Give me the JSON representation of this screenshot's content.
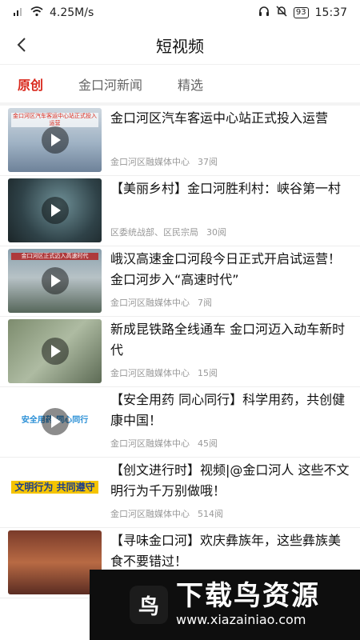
{
  "status_bar": {
    "speed": "4.25M/s",
    "battery": "93",
    "time": "15:37"
  },
  "header": {
    "title": "短视频"
  },
  "tabs": [
    {
      "label": "原创",
      "active": true
    },
    {
      "label": "金口河新闻",
      "active": false
    },
    {
      "label": "精选",
      "active": false
    }
  ],
  "items": [
    {
      "title": "金口河区汽车客运中心站正式投入运营",
      "source": "金口河区融媒体中心",
      "views": "37阅",
      "thumb_text": "金口河区汽车客运中心站正式投入运营"
    },
    {
      "title": "【美丽乡村】金口河胜利村：峡谷第一村",
      "source": "区委统战部、区民宗局",
      "views": "30阅",
      "thumb_text": ""
    },
    {
      "title": "峨汉高速金口河段今日正式开启试运营！金口河步入“高速时代”",
      "source": "金口河区融媒体中心",
      "views": "7阅",
      "thumb_text": "金口河区正式迈入高速时代"
    },
    {
      "title": "新成昆铁路全线通车 金口河迈入动车新时代",
      "source": "金口河区融媒体中心",
      "views": "15阅",
      "thumb_text": ""
    },
    {
      "title": "【安全用药 同心同行】科学用药，共创健康中国！",
      "source": "金口河区融媒体中心",
      "views": "45阅",
      "thumb_text": "安全用药 同心同行"
    },
    {
      "title": "【创文进行时】视频|@金口河人 这些不文明行为千万别做哦！",
      "source": "金口河区融媒体中心",
      "views": "514阅",
      "thumb_text": "文明行为 共同遵守"
    },
    {
      "title": "【寻味金口河】欢庆彝族年，这些彝族美食不要错过！",
      "source": "",
      "views": "",
      "thumb_text": ""
    }
  ],
  "watermark": {
    "logo": "鸟",
    "name": "下载鸟资源",
    "url": "www.xiazainiao.com"
  }
}
